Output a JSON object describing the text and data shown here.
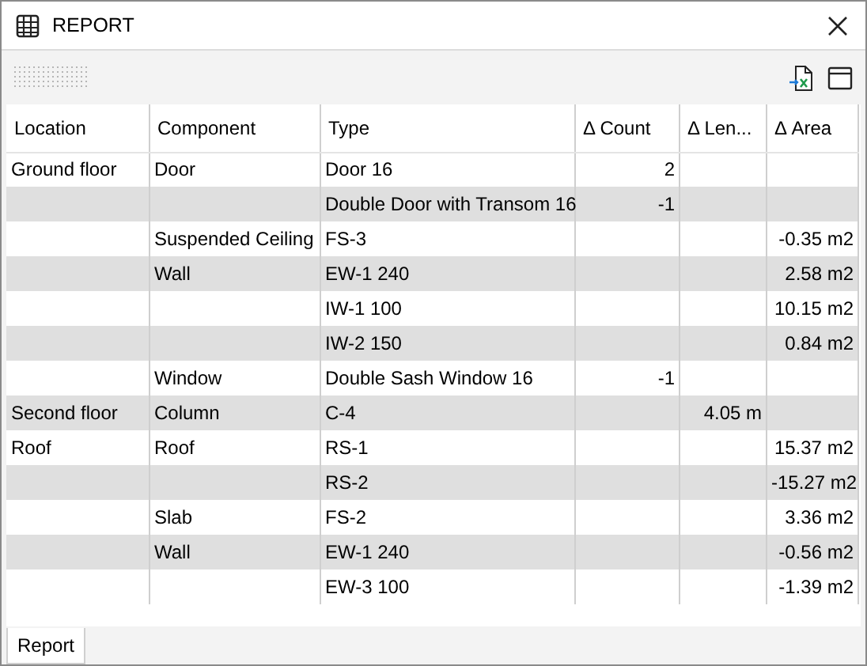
{
  "window": {
    "title": "REPORT"
  },
  "table": {
    "columns": [
      "Location",
      "Component",
      "Type",
      "Δ Count",
      "Δ Len...",
      "Δ Area"
    ],
    "rows": [
      {
        "location": "Ground floor",
        "component": "Door",
        "type": "Door 16",
        "count": "2"
      },
      {
        "type": "Double Door with Transom 16",
        "count": "-1"
      },
      {
        "component": "Suspended Ceiling",
        "type": "FS-3",
        "area": "-0.35 m2"
      },
      {
        "component": "Wall",
        "type": "EW-1 240",
        "area": "2.58 m2"
      },
      {
        "type": "IW-1 100",
        "area": "10.15 m2"
      },
      {
        "type": "IW-2 150",
        "area": "0.84 m2"
      },
      {
        "component": "Window",
        "type": "Double Sash Window 16",
        "count": "-1"
      },
      {
        "location": "Second floor",
        "component": "Column",
        "type": "C-4",
        "length": "4.05 m"
      },
      {
        "location": "Roof",
        "component": "Roof",
        "type": "RS-1",
        "area": "15.37 m2"
      },
      {
        "type": "RS-2",
        "area": "-15.27 m2"
      },
      {
        "component": "Slab",
        "type": "FS-2",
        "area": "3.36 m2"
      },
      {
        "component": "Wall",
        "type": "EW-1 240",
        "area": "-0.56 m2"
      },
      {
        "type": "EW-3 100",
        "area": "-1.39 m2"
      }
    ]
  },
  "tabs": [
    {
      "label": "Report",
      "selected": true
    }
  ]
}
